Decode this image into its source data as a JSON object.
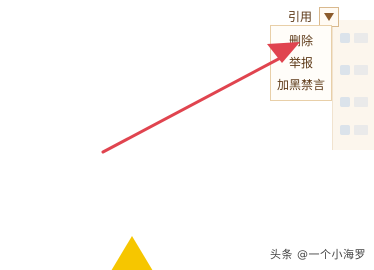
{
  "toolbar": {
    "quote_label": "引用"
  },
  "menu": {
    "items": [
      {
        "label": "删除"
      },
      {
        "label": "举报"
      },
      {
        "label": "加黑禁言"
      }
    ]
  },
  "watermark": {
    "text": "头条 @一个小海罗"
  },
  "colors": {
    "arrow": "#e0444f",
    "menu_text": "#5e3a18",
    "menu_border": "#e8cfa8",
    "yellow": "#f6c600"
  }
}
